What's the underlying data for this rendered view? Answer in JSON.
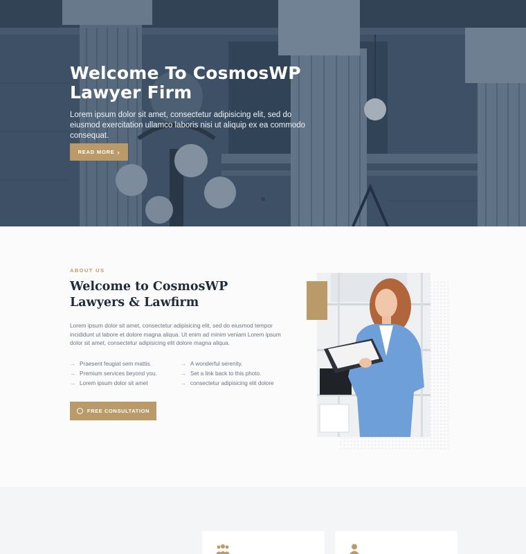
{
  "hero": {
    "title": "Welcome To CosmosWP Lawyer Firm",
    "text": "Lorem ipsum dolor sit amet, consectetur adipisicing elit, sed do eiusmod exercitation ullamco laboris nisi ut aliquip ex ea commodo consequat.",
    "button_label": "READ MORE",
    "button_icon": "chevron-right-icon"
  },
  "about": {
    "label": "ABOUT US",
    "title": "Welcome to CosmosWP Lawyers & Lawfirm",
    "paragraph": "Lorem ipsum dolor sit amet, consectetur adipisicing elit, sed do eiusmod tempor incididunt ut labore et dolore magna aliqua. Ut enim ad minim veniam Lorem ipsum dolor sit amet, consectetur adipisicing elit dolore magna aliqua.",
    "features_left": [
      "Praesent feugiat sem mattis.",
      "Premium services beyond you.",
      "Lorem ipsum dolor sit amet"
    ],
    "features_right": [
      "A wonderful serenity.",
      "Set a link back to this photo.",
      "consectetur adipisicing elit dolore"
    ],
    "button_label": "FREE CONSULTATION",
    "button_icon": "chat-bubble-icon"
  },
  "cards": [
    {
      "icon": "users-icon"
    },
    {
      "icon": "user-icon"
    }
  ],
  "colors": {
    "accent": "#b99a68",
    "heading": "#1f2a3a",
    "body_text": "#6b7380"
  }
}
